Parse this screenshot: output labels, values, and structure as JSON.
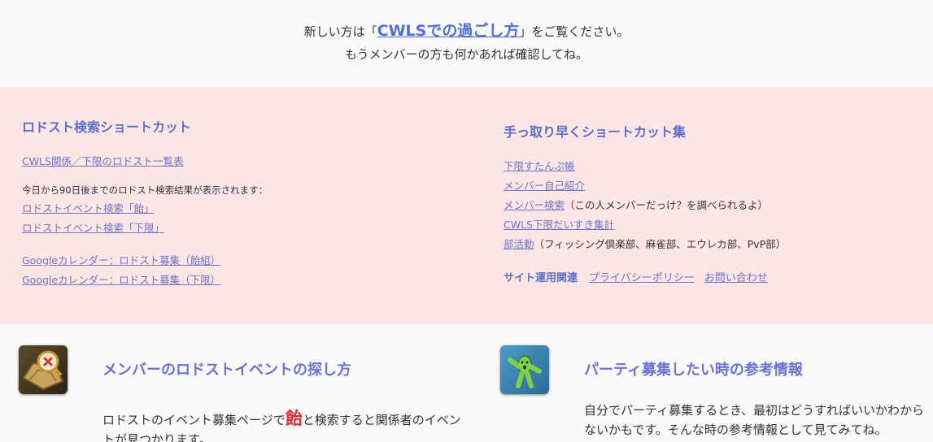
{
  "intro": {
    "line1_before": "新しい方は「",
    "line1_link": "CWLSでの過ごし方",
    "line1_after": "」をご覧ください。",
    "line2": "もうメンバーの方も何かあれば確認してね。"
  },
  "left": {
    "title": "ロドスト検索ショートカット",
    "link_list": "CWLS関係／下限のロドスト一覧表",
    "note": "今日から90日後までのロドスト検索結果が表示されます：",
    "search_links": [
      "ロドストイベント検索「飴」",
      "ロドストイベント検索「下限」"
    ],
    "calendar_links": [
      "Googleカレンダー：ロドスト募集（飴組）",
      "Googleカレンダー：ロドスト募集（下限）"
    ]
  },
  "right": {
    "title": "手っ取り早くショートカット集",
    "links": [
      {
        "text": "下限すたんぷ帳",
        "desc": ""
      },
      {
        "text": "メンバー自己紹介",
        "desc": ""
      },
      {
        "text": "メンバー検索",
        "desc": "（この人メンバーだっけ？を調べられるよ）"
      },
      {
        "text": "CWLS下限だいすき集計",
        "desc": ""
      },
      {
        "text": "部活動",
        "desc": "（フィッシング倶楽部、麻雀部、エウレカ部、PvP部）"
      }
    ],
    "site_label": "サイト運用関連",
    "privacy": "プライバシーポリシー",
    "contact": "お問い合わせ"
  },
  "cards": {
    "left_title": "メンバーのロドストイベントの探し方",
    "left_text_a": "ロドストのイベント募集ページで",
    "left_text_red": "飴",
    "left_text_b": "と検索すると関係者のイベントが見つかります。",
    "right_title": "パーティ募集したい時の参考情報",
    "right_text": "自分でパーティ募集するとき、最初はどうすればいいかわからないかもです。そんな時の参考情報として見てみてね。"
  }
}
